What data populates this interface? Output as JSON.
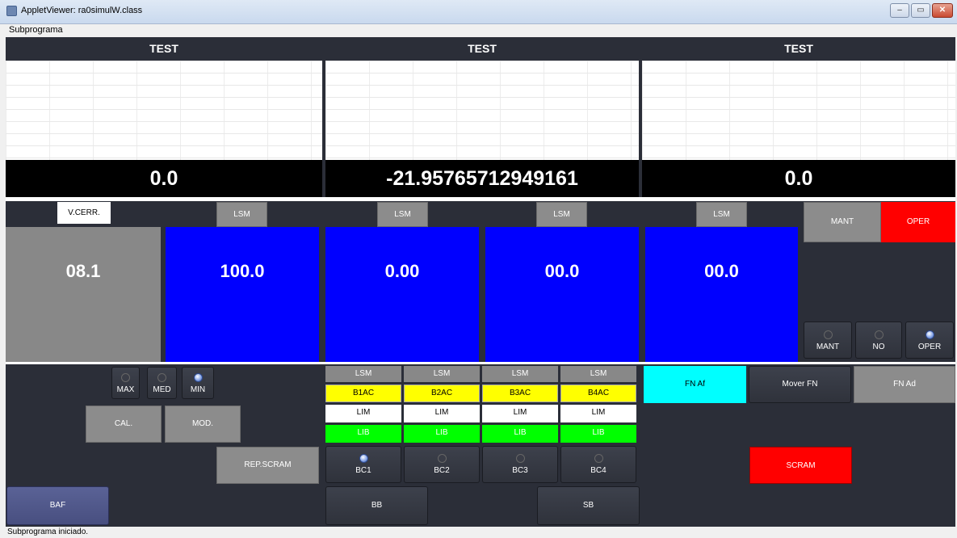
{
  "window": {
    "title": "AppletViewer: ra0simulW.class",
    "minimize": "–",
    "maximize": "▭",
    "close": "✕"
  },
  "menu": {
    "item": "Subprograma"
  },
  "panels": [
    {
      "title": "TEST",
      "value": "0.0"
    },
    {
      "title": "TEST",
      "value": "-21.95765712949161"
    },
    {
      "title": "TEST",
      "value": "0.0"
    }
  ],
  "top_row": {
    "vcerr": "V.CERR.",
    "lsm": [
      "LSM",
      "LSM",
      "LSM",
      "LSM"
    ],
    "mant": "MANT",
    "oper": "OPER"
  },
  "big_values": {
    "gray": "08.1",
    "blue": [
      "100.0",
      "0.00",
      "00.0",
      "00.0"
    ]
  },
  "mode_radios": [
    {
      "label": "MANT",
      "selected": false
    },
    {
      "label": "NO",
      "selected": false
    },
    {
      "label": "OPER",
      "selected": true
    }
  ],
  "range_radios": [
    {
      "label": "MAX",
      "selected": false
    },
    {
      "label": "MED",
      "selected": false
    },
    {
      "label": "MIN",
      "selected": true
    }
  ],
  "buttons": {
    "cal": "CAL.",
    "mod": "MOD.",
    "rep_scram": "REP.SCRAM",
    "baf": "BAF",
    "bb": "BB",
    "sb": "SB",
    "fn_af": "FN Af",
    "mover_fn": "Mover FN",
    "fn_ad": "FN Ad",
    "scram": "SCRAM"
  },
  "bar_columns": [
    {
      "lsm": "LSM",
      "ac": "B1AC",
      "lim": "LIM",
      "lib": "LIB",
      "bc": "BC1",
      "selected": true
    },
    {
      "lsm": "LSM",
      "ac": "B2AC",
      "lim": "LIM",
      "lib": "LIB",
      "bc": "BC2",
      "selected": false
    },
    {
      "lsm": "LSM",
      "ac": "B3AC",
      "lim": "LIM",
      "lib": "LIB",
      "bc": "BC3",
      "selected": false
    },
    {
      "lsm": "LSM",
      "ac": "B4AC",
      "lim": "LIM",
      "lib": "LIB",
      "bc": "BC4",
      "selected": false
    }
  ],
  "status": "Subprograma iniciado.",
  "colors": {
    "blue": "#0000ff",
    "red": "#ff0000",
    "cyan": "#00ffff",
    "yellow": "#ffff00",
    "green": "#00ff00",
    "background": "#2b2e38"
  }
}
